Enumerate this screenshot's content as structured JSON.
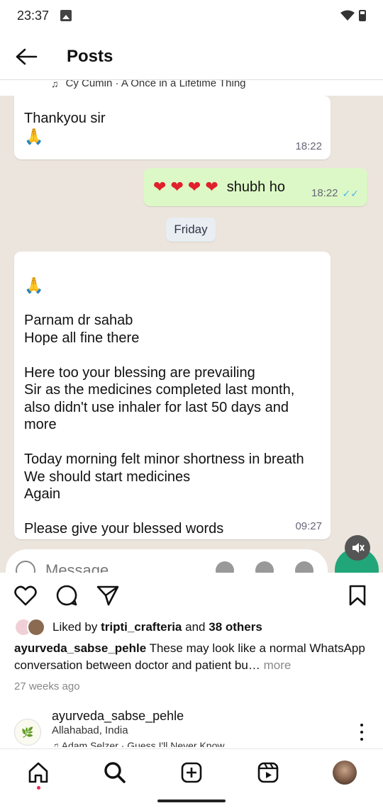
{
  "status_bar": {
    "time": "23:37"
  },
  "header": {
    "title": "Posts"
  },
  "media": {
    "music_strip": "Cy Cumin · A Once in a Lifetime Thing",
    "messages": [
      {
        "text": "Thankyou sir",
        "emoji": "🙏",
        "time": "18:22"
      },
      {
        "text": "shubh ho",
        "time": "18:22",
        "hearts": 4
      },
      {
        "text": "Parnam dr sahab\nHope all fine there\n\nHere too your blessing are prevailing\nSir as the medicines completed last month, also didn't use inhaler for last 50 days and more\n\nToday morning felt minor shortness in breath\nWe should start medicines\nAgain\n\nPlease give your blessed words",
        "emoji": "🙏",
        "time": "09:27"
      }
    ],
    "day_chip": "Friday",
    "composer_placeholder": "Message"
  },
  "likes": {
    "liked_by_prefix": "Liked by",
    "liked_by_user": "tripti_crafteria",
    "and": "and",
    "others": "38 others"
  },
  "caption": {
    "username": "ayurveda_sabse_pehle",
    "text": "These may look like a normal WhatsApp conversation between doctor and patient bu…",
    "more": "more"
  },
  "time_ago": "27 weeks ago",
  "next_post": {
    "username": "ayurveda_sabse_pehle",
    "location": "Allahabad, India",
    "music": "Adam Selzer · Guess I'll Never Know"
  },
  "icons": [
    "back-arrow-icon",
    "heart-icon",
    "comment-icon",
    "share-icon",
    "bookmark-icon",
    "home-icon",
    "search-icon",
    "create-icon",
    "reels-icon",
    "more-icon"
  ]
}
